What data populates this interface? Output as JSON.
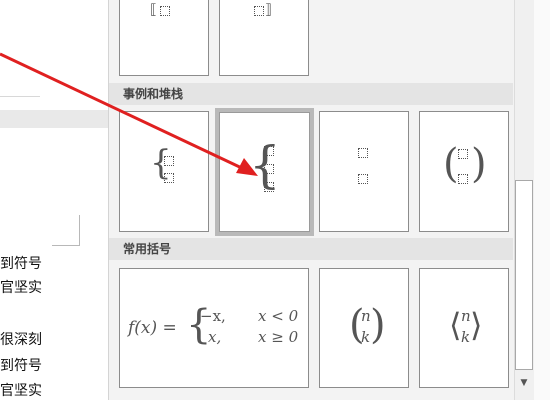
{
  "document": {
    "lines": [
      "到符号",
      "官坚实",
      "很深刻",
      "到符号",
      "官坚实"
    ]
  },
  "gallery": {
    "section_cases": "事例和堆栈",
    "section_common": "常用括号",
    "piecewise": {
      "lhs": "f(x) =",
      "row1_expr": "−x,",
      "row1_cond": "x < 0",
      "row2_expr": "x,",
      "row2_cond": "x ≥ 0"
    },
    "binom_top": "n",
    "binom_bottom": "k",
    "angle_top": "n",
    "angle_bottom": "k"
  },
  "colors": {
    "arrow": "#e02020",
    "tile_border": "#8c8c8c",
    "selected_border": "#b9b9b9"
  },
  "icons": [
    "double-bracket-left-icon",
    "bracket-right-icon",
    "scroll-down-arrow-icon"
  ]
}
